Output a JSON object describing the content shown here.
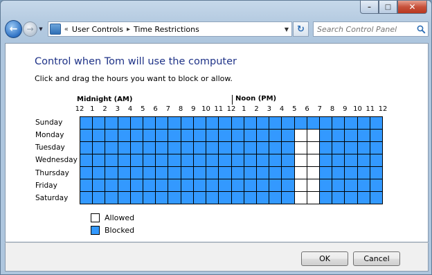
{
  "window": {
    "minimize_glyph": "–",
    "maximize_glyph": "□",
    "close_glyph": "✕"
  },
  "address_bar": {
    "overflow_glyph": "«",
    "breadcrumbs": [
      "User Controls",
      "Time Restrictions"
    ],
    "separator": "▸"
  },
  "search": {
    "placeholder": "Search Control Panel"
  },
  "page": {
    "title": "Control when Tom will use the computer",
    "instruction": "Click and drag the hours you want to block or allow."
  },
  "schedule": {
    "am_marker": "Midnight (AM)",
    "pm_marker": "Noon (PM)",
    "hour_labels": [
      "12",
      "1",
      "2",
      "3",
      "4",
      "5",
      "6",
      "7",
      "8",
      "9",
      "10",
      "11",
      "12",
      "1",
      "2",
      "3",
      "4",
      "5",
      "6",
      "7",
      "8",
      "9",
      "10",
      "11",
      "12"
    ],
    "days": [
      "Sunday",
      "Monday",
      "Tuesday",
      "Wednesday",
      "Thursday",
      "Friday",
      "Saturday"
    ],
    "allowed_hours": {
      "Sunday": [],
      "Monday": [
        17,
        18
      ],
      "Tuesday": [
        17,
        18
      ],
      "Wednesday": [
        17,
        18
      ],
      "Thursday": [
        17,
        18
      ],
      "Friday": [
        17,
        18
      ],
      "Saturday": [
        17,
        18
      ]
    },
    "colors": {
      "blocked": "#3399ff",
      "allowed": "#ffffff"
    }
  },
  "legend": {
    "allowed": "Allowed",
    "blocked": "Blocked"
  },
  "buttons": {
    "ok": "OK",
    "cancel": "Cancel"
  }
}
